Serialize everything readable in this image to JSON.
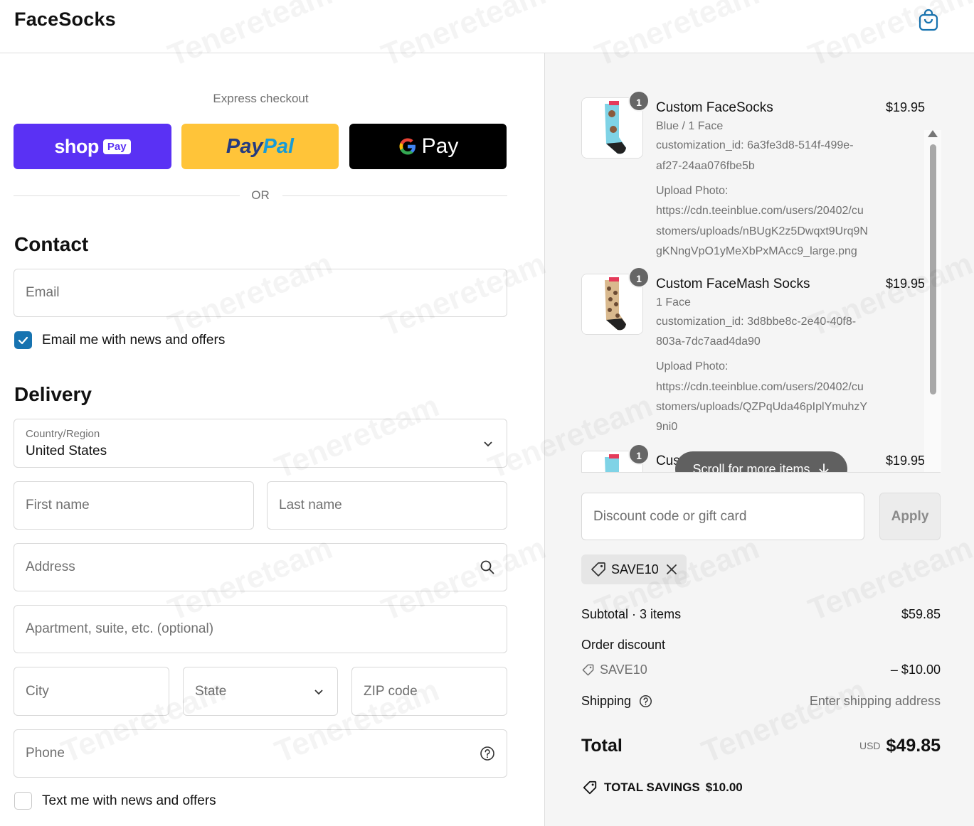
{
  "header": {
    "logo": "FaceSocks"
  },
  "express": {
    "title": "Express checkout",
    "shop_word": "shop",
    "shop_badge": "Pay",
    "paypal_part1": "Pay",
    "paypal_part2": "Pal",
    "gpay_g": "G",
    "gpay_text": "Pay",
    "or_text": "OR"
  },
  "contact": {
    "title": "Contact",
    "email_placeholder": "Email",
    "news_checked": true,
    "news_label": "Email me with news and offers"
  },
  "delivery": {
    "title": "Delivery",
    "country_label": "Country/Region",
    "country_value": "United States",
    "first_name_placeholder": "First name",
    "last_name_placeholder": "Last name",
    "address_placeholder": "Address",
    "apartment_placeholder": "Apartment, suite, etc. (optional)",
    "city_placeholder": "City",
    "state_placeholder": "State",
    "zip_placeholder": "ZIP code",
    "phone_placeholder": "Phone",
    "sms_checked": false,
    "sms_label": "Text me with news and offers"
  },
  "cart": {
    "items": [
      {
        "quantity": "1",
        "name": "Custom FaceSocks",
        "price": "$19.95",
        "variant": "Blue / 1 Face",
        "lines": [
          "customization_id: 6a3fe3d8-514f-499e-",
          "af27-24aa076fbe5b",
          "Upload Photo:",
          "https://cdn.teeinblue.com/users/20402/cu",
          "stomers/uploads/nBUgK2z5Dwqxt9Urq9N",
          "gKNngVpO1yMeXbPxMAcc9_large.png"
        ]
      },
      {
        "quantity": "1",
        "name": "Custom FaceMash Socks",
        "price": "$19.95",
        "variant": "1 Face",
        "lines": [
          "customization_id: 3d8bbe8c-2e40-40f8-",
          "803a-7dc7aad4da90",
          "Upload Photo:",
          "https://cdn.teeinblue.com/users/20402/cu",
          "stomers/uploads/QZPqUda46pIplYmuhzY",
          "9ni0"
        ]
      },
      {
        "quantity": "1",
        "name": "Custom FaceSocks",
        "price": "$19.95"
      }
    ],
    "scroll_hint": "Scroll for more items",
    "discount_placeholder": "Discount code or gift card",
    "apply_label": "Apply",
    "applied_code": "SAVE10"
  },
  "summary": {
    "subtotal_label": "Subtotal · 3 items",
    "subtotal_value": "$59.85",
    "order_discount_label": "Order discount",
    "discount_code": "SAVE10",
    "discount_value": "– $10.00",
    "shipping_label": "Shipping",
    "shipping_value": "Enter shipping address",
    "total_label": "Total",
    "currency": "USD",
    "total_value": "$49.85",
    "savings_label": "TOTAL SAVINGS",
    "savings_value": "$10.00"
  },
  "colors": {
    "shop_purple": "#5a31f4",
    "paypal_yellow": "#ffc439",
    "checkbox_blue": "#1773b0",
    "summary_bg": "#f5f5f5"
  },
  "watermark_text": "Tenereteam"
}
